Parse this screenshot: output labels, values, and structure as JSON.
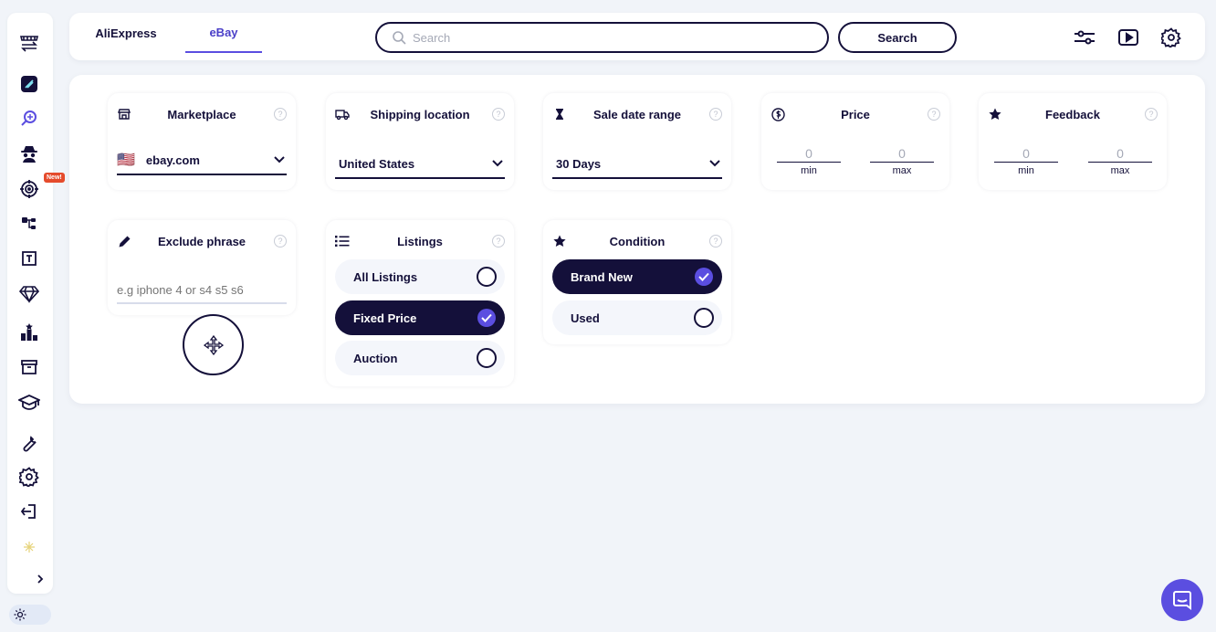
{
  "header": {
    "tabs": [
      {
        "label": "AliExpress"
      },
      {
        "label": "eBay"
      }
    ],
    "active_tab": "eBay",
    "search": {
      "placeholder": "Search",
      "value": ""
    },
    "search_button_label": "Search",
    "icons": [
      "sliders-icon",
      "video-play-icon",
      "settings-gear-icon"
    ]
  },
  "sidebar": {
    "new_badge": "New!",
    "icons": [
      "store-swap-icon",
      "app-logo-icon",
      "product-search-icon",
      "spy-icon",
      "competitor-target-icon",
      "category-tree-icon",
      "title-builder-icon",
      "premium-diamond-icon",
      "top-sellers-icon",
      "archive-icon",
      "academy-icon",
      "tools-icon",
      "settings-icon",
      "logout-icon",
      "sparkle-icon"
    ]
  },
  "filters": {
    "marketplace": {
      "title": "Marketplace",
      "flag": "🇺🇸",
      "value": "ebay.com"
    },
    "shipping": {
      "title": "Shipping location",
      "value": "United States"
    },
    "sale_date": {
      "title": "Sale date range",
      "value": "30 Days"
    },
    "price": {
      "title": "Price",
      "min_value": "0",
      "min_label": "min",
      "max_value": "0",
      "max_label": "max"
    },
    "feedback": {
      "title": "Feedback",
      "min_value": "0",
      "min_label": "min",
      "max_value": "0",
      "max_label": "max"
    },
    "exclude": {
      "title": "Exclude phrase",
      "placeholder": "e.g iphone 4 or s4 s5 s6"
    },
    "listings": {
      "title": "Listings",
      "options": [
        {
          "label": "All Listings",
          "checked": false
        },
        {
          "label": "Fixed Price",
          "checked": true
        },
        {
          "label": "Auction",
          "checked": false
        }
      ]
    },
    "condition": {
      "title": "Condition",
      "options": [
        {
          "label": "Brand New",
          "checked": true
        },
        {
          "label": "Used",
          "checked": false
        }
      ]
    },
    "help_glyph": "?"
  },
  "colors": {
    "accent": "#5b4ee0",
    "dark": "#14103a",
    "background": "#f1f4f9",
    "badge": "#e54b2c"
  }
}
